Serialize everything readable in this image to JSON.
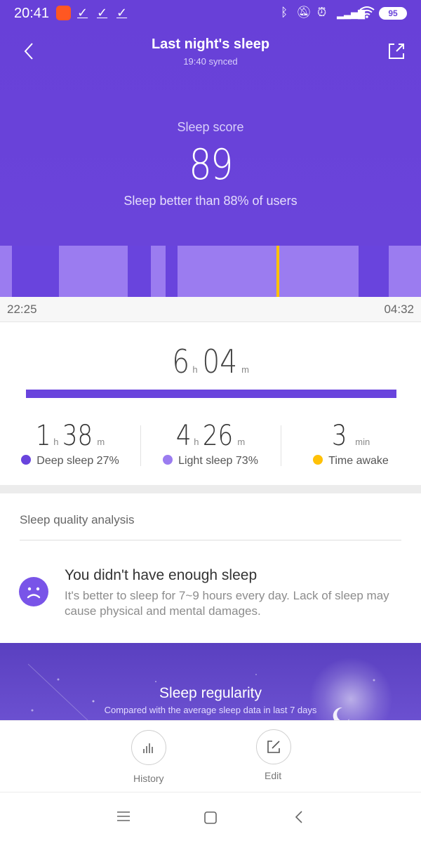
{
  "status_bar": {
    "time": "20:41",
    "battery": "95",
    "icons": [
      "app-icon",
      "check-icon",
      "check-icon",
      "check-icon",
      "bluetooth-icon",
      "mute-icon",
      "alarm-icon",
      "signal-icon",
      "wifi-icon",
      "battery-icon"
    ]
  },
  "header": {
    "title": "Last night's sleep",
    "synced": "19:40 synced",
    "score_label": "Sleep score",
    "score": "89",
    "comparison": "Sleep better than 88% of users"
  },
  "timeline": {
    "start": "22:25",
    "end": "04:32",
    "colors": {
      "deep": "#6944dd",
      "light": "#9b7cf0",
      "awake": "#ffc107"
    }
  },
  "total": {
    "hours": "6",
    "hours_unit": "h",
    "minutes": "04",
    "minutes_unit": "m"
  },
  "breakdown": [
    {
      "h": "1",
      "h_unit": "h",
      "m": "38",
      "m_unit": "m",
      "label": "Deep sleep 27%",
      "color": "#6944dd"
    },
    {
      "h": "4",
      "h_unit": "h",
      "m": "26",
      "m_unit": "m",
      "label": "Light sleep 73%",
      "color": "#9b7cf0"
    },
    {
      "value": "3",
      "unit": "min",
      "label": "Time awake",
      "color": "#ffc107"
    }
  ],
  "quality": {
    "section_title": "Sleep quality analysis",
    "headline": "You didn't have enough sleep",
    "body": "It's better to sleep for 7~9 hours every day. Lack of sleep may cause physical and mental damages."
  },
  "regularity": {
    "title": "Sleep regularity",
    "subtitle": "Compared with the average sleep data in last 7 days"
  },
  "actions": {
    "history": "History",
    "edit": "Edit"
  }
}
